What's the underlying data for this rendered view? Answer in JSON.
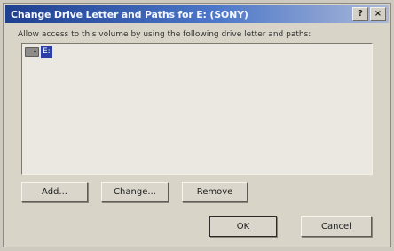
{
  "window": {
    "title": "Change Drive Letter and Paths for E: (SONY)",
    "help_glyph": "?",
    "close_glyph": "×"
  },
  "prompt": "Allow access to this volume by using the following drive letter and paths:",
  "list": {
    "items": [
      {
        "icon": "drive-icon",
        "label": "E:",
        "selected": true
      }
    ]
  },
  "buttons": {
    "add": "Add...",
    "change": "Change...",
    "remove": "Remove",
    "ok": "OK",
    "cancel": "Cancel"
  },
  "colors": {
    "title_bar": "#1f3f8f",
    "selection": "#2a3ea6",
    "dialog_bg": "#d9d4c8"
  }
}
